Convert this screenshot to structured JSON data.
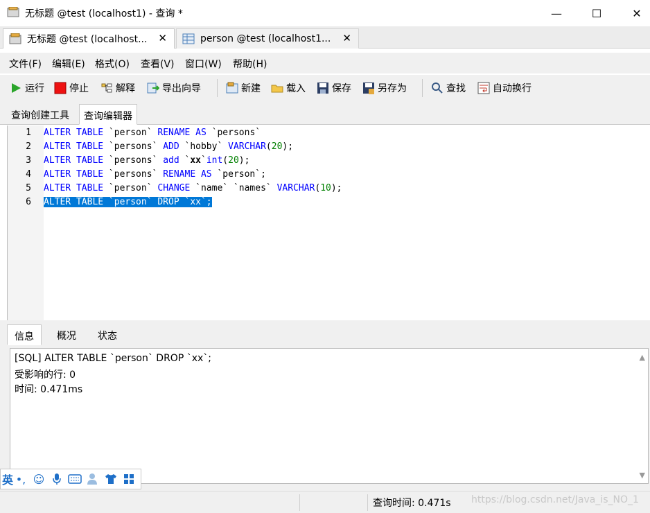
{
  "window": {
    "title": "无标题 @test (localhost1) - 查询 *",
    "controls": {
      "minimize": "—",
      "maximize": "☐",
      "close": "✕"
    }
  },
  "doc_tabs": [
    {
      "label": "无标题 @test (localhost...",
      "close": "✕"
    },
    {
      "label": "person @test (localhost1...",
      "close": "✕"
    }
  ],
  "menu": [
    "文件(F)",
    "编辑(E)",
    "格式(O)",
    "查看(V)",
    "窗口(W)",
    "帮助(H)"
  ],
  "toolbar": {
    "run": "运行",
    "stop": "停止",
    "explain": "解释",
    "export_wizard": "导出向导",
    "new": "新建",
    "load": "载入",
    "save": "保存",
    "save_as": "另存为",
    "find": "查找",
    "word_wrap": "自动换行"
  },
  "query_tabs": [
    "查询创建工具",
    "查询编辑器"
  ],
  "editor": {
    "line_numbers": [
      "1",
      "2",
      "3",
      "4",
      "5",
      "6"
    ]
  },
  "info_tabs": [
    "信息",
    "概况",
    "状态"
  ],
  "info": {
    "sql": "[SQL] ALTER TABLE `person` DROP `xx`;",
    "affected": "受影响的行: 0",
    "time": "时间: 0.471ms"
  },
  "status": {
    "query_time": "查询时间: 0.471s",
    "watermark": "https://blog.csdn.net/Java_is_NO_1"
  },
  "ime": {
    "lang": "英"
  },
  "colors": {
    "keyword": "#0000ff",
    "number": "#008000",
    "selection": "#0078d7"
  }
}
